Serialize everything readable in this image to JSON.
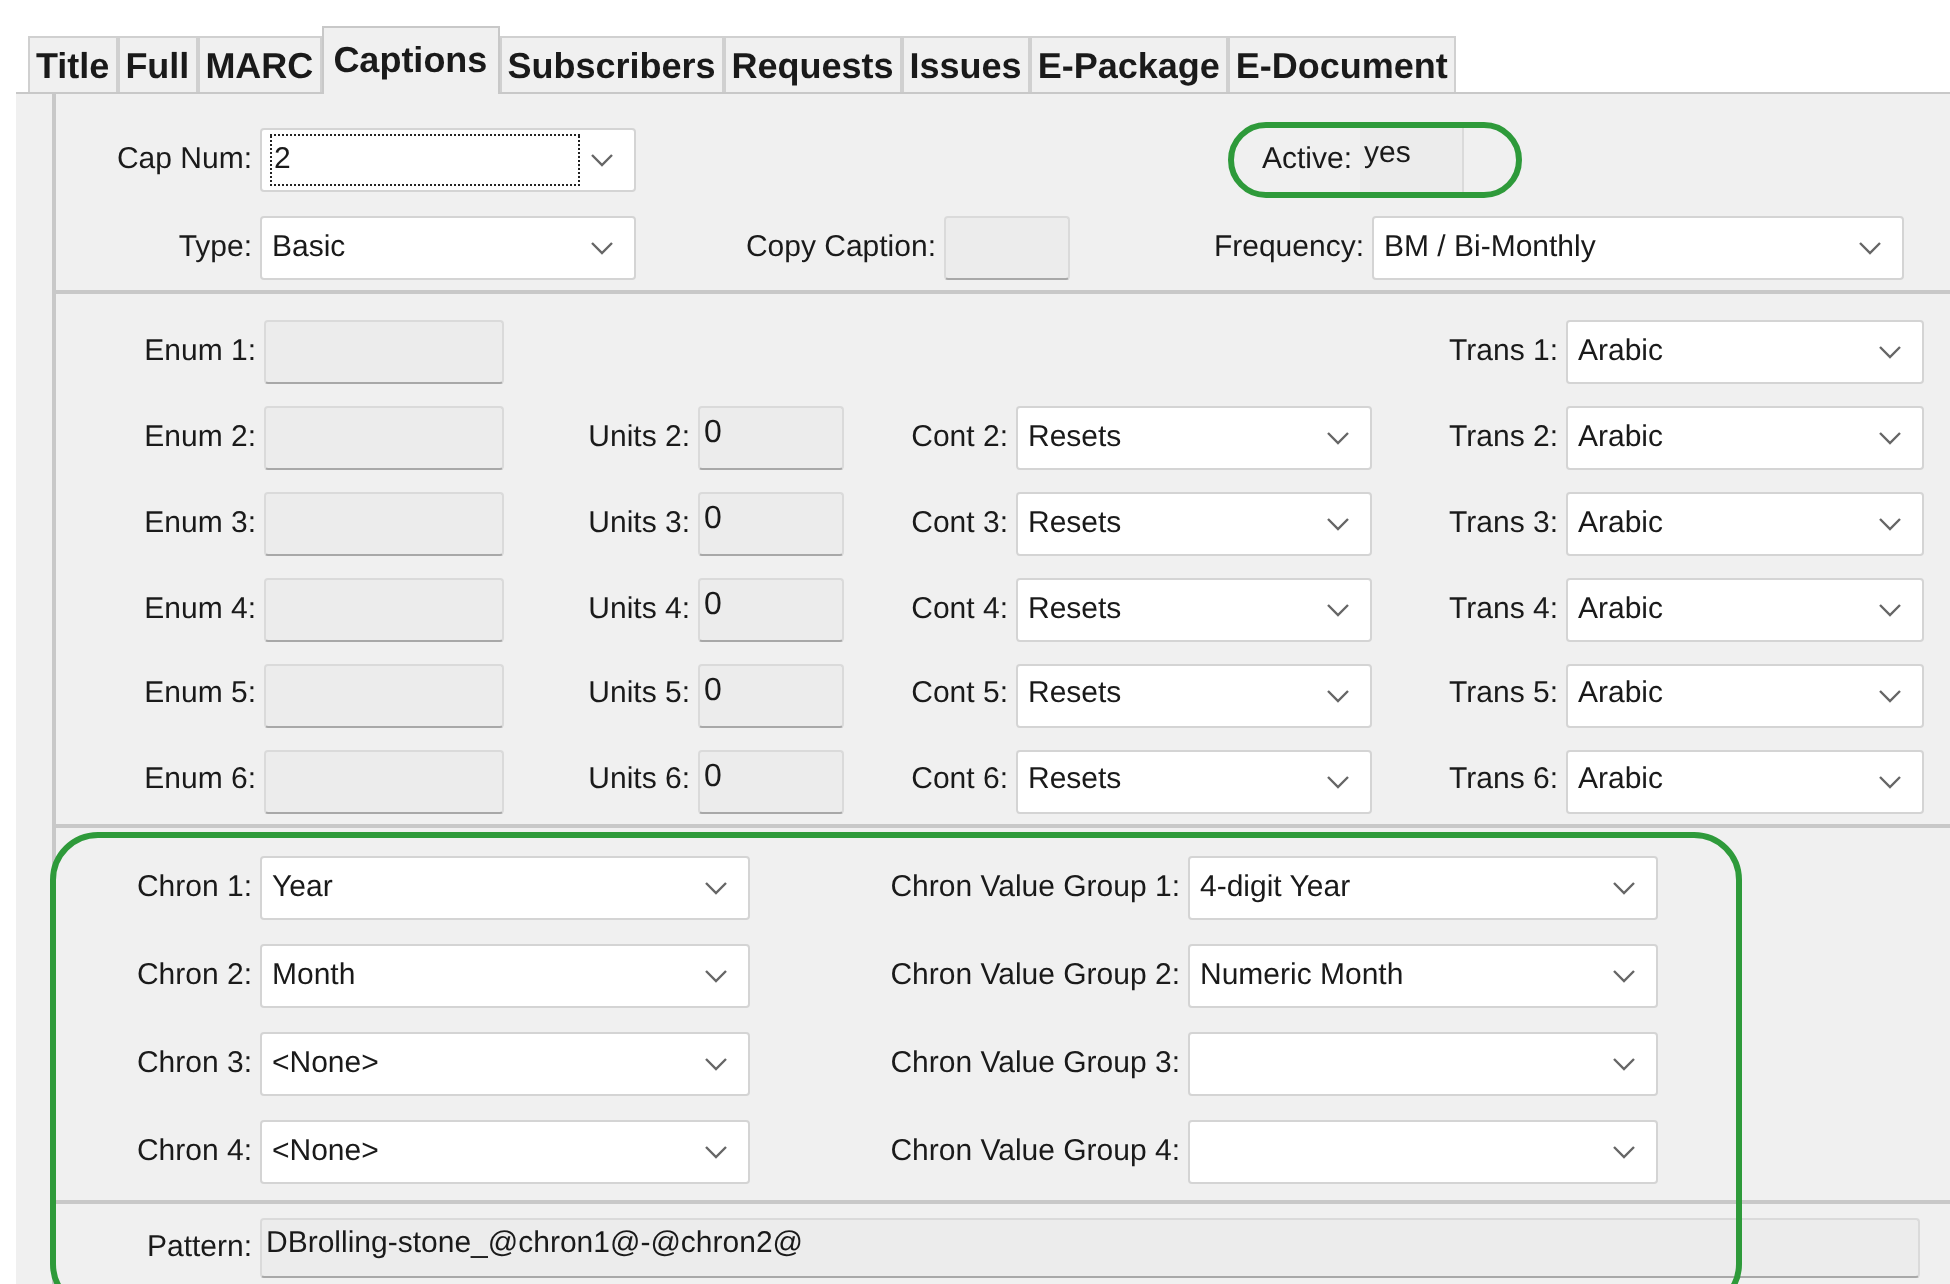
{
  "tabs": [
    {
      "label": "Title",
      "selected": false
    },
    {
      "label": "Full",
      "selected": false
    },
    {
      "label": "MARC",
      "selected": false
    },
    {
      "label": "Captions",
      "selected": true
    },
    {
      "label": "Subscribers",
      "selected": false
    },
    {
      "label": "Requests",
      "selected": false
    },
    {
      "label": "Issues",
      "selected": false
    },
    {
      "label": "E-Package",
      "selected": false
    },
    {
      "label": "E-Document",
      "selected": false
    }
  ],
  "cap_num": {
    "label": "Cap Num:",
    "value": "2",
    "focused": true
  },
  "active": {
    "label": "Active:",
    "value": "yes",
    "highlighted": true
  },
  "type": {
    "label": "Type:",
    "value": "Basic"
  },
  "copy_caption": {
    "label": "Copy Caption:"
  },
  "frequency": {
    "label": "Frequency:",
    "value": "BM / Bi-Monthly"
  },
  "enum_rows": [
    {
      "enum_label": "Enum 1:",
      "trans_label": "Trans 1:",
      "trans_value": "Arabic"
    },
    {
      "enum_label": "Enum 2:",
      "units_label": "Units 2:",
      "units_value": "0",
      "cont_label": "Cont 2:",
      "cont_value": "Resets",
      "trans_label": "Trans 2:",
      "trans_value": "Arabic"
    },
    {
      "enum_label": "Enum 3:",
      "units_label": "Units 3:",
      "units_value": "0",
      "cont_label": "Cont 3:",
      "cont_value": "Resets",
      "trans_label": "Trans 3:",
      "trans_value": "Arabic"
    },
    {
      "enum_label": "Enum 4:",
      "units_label": "Units 4:",
      "units_value": "0",
      "cont_label": "Cont 4:",
      "cont_value": "Resets",
      "trans_label": "Trans 4:",
      "trans_value": "Arabic"
    },
    {
      "enum_label": "Enum 5:",
      "units_label": "Units 5:",
      "units_value": "0",
      "cont_label": "Cont 5:",
      "cont_value": "Resets",
      "trans_label": "Trans 5:",
      "trans_value": "Arabic"
    },
    {
      "enum_label": "Enum 6:",
      "units_label": "Units 6:",
      "units_value": "0",
      "cont_label": "Cont 6:",
      "cont_value": "Resets",
      "trans_label": "Trans 6:",
      "trans_value": "Arabic"
    }
  ],
  "chron_section": {
    "highlighted": true,
    "rows": [
      {
        "chron_label": "Chron 1:",
        "chron_value": "Year",
        "group_label": "Chron Value Group 1:",
        "group_value": "4-digit Year"
      },
      {
        "chron_label": "Chron 2:",
        "chron_value": "Month",
        "group_label": "Chron Value Group 2:",
        "group_value": "Numeric Month"
      },
      {
        "chron_label": "Chron 3:",
        "chron_value": "<None>",
        "group_label": "Chron Value Group 3:"
      },
      {
        "chron_label": "Chron 4:",
        "chron_value": "<None>",
        "group_label": "Chron Value Group 4:"
      }
    ],
    "pattern": {
      "label": "Pattern:",
      "value": "DBrolling-stone_@chron1@-@chron2@"
    }
  }
}
